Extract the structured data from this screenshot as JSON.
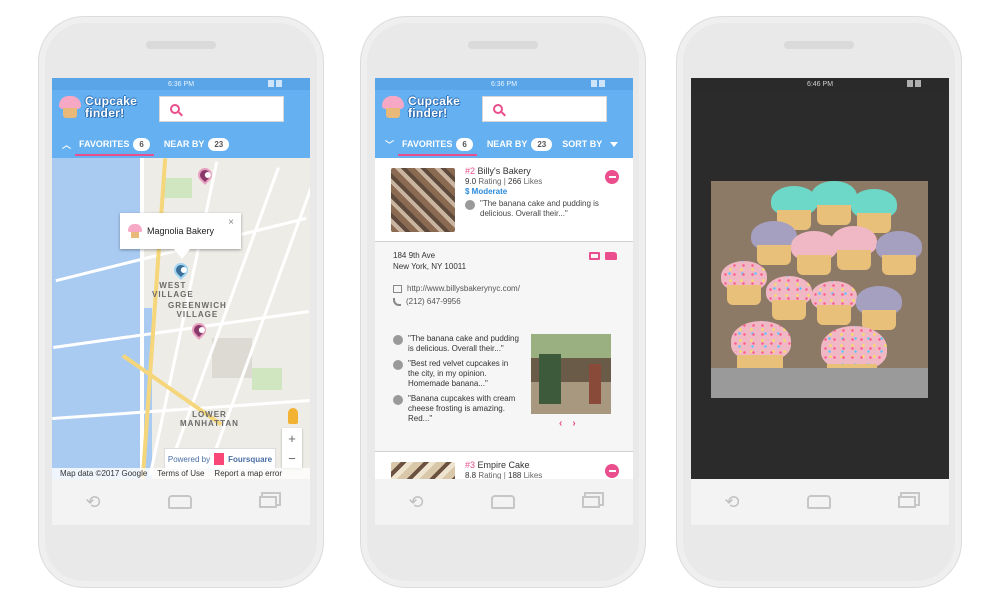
{
  "app": {
    "logo_line1": "Cupcake",
    "logo_line2": "finder!",
    "search_placeholder": ""
  },
  "status_times": [
    "6:36 PM",
    "6:36 PM",
    "6:46 PM"
  ],
  "tabs": {
    "favorites_label": "FAVORITES",
    "favorites_count": "6",
    "nearby_label": "NEAR BY",
    "nearby_count": "23",
    "sort_label": "SORT BY"
  },
  "map": {
    "popup_title": "Magnolia Bakery",
    "popup_close": "×",
    "labels": {
      "west_village_1": "WEST",
      "west_village_2": "VILLAGE",
      "greenwich_1": "GREENWICH",
      "greenwich_2": "VILLAGE",
      "lower_manhattan_1": "LOWER",
      "lower_manhattan_2": "MANHATTAN"
    },
    "powered_by": "Powered by",
    "powered_brand": "Foursquare",
    "attribution": {
      "data": "Map data ©2017 Google",
      "terms": "Terms of Use",
      "report": "Report a map error"
    },
    "zoom_in": "+",
    "zoom_out": "−"
  },
  "list": {
    "items": [
      {
        "rank": "#2",
        "name": "Billy's Bakery",
        "rating": "9.0",
        "rating_label": "Rating",
        "likes": "266",
        "likes_label": "Likes",
        "price": "$ Moderate",
        "review_snippet": "\"The banana cake and pudding is delicious. Overall their...\""
      },
      {
        "rank": "#3",
        "name": "Empire Cake",
        "rating": "8.8",
        "rating_label": "Rating",
        "likes": "188",
        "likes_label": "Likes"
      }
    ],
    "details": {
      "address_line1": "184 9th Ave",
      "address_line2": "New York, NY 10011",
      "website": "http://www.billysbakerynyc.com/",
      "phone": "(212) 647-9956",
      "reviews": [
        "\"The banana cake and pudding is delicious. Overall their...\"",
        "\"Best red velvet cupcakes in the city, in my opinion. Homemade banana...\"",
        "\"Banana cupcakes with cream cheese frosting is amazing. Red...\""
      ],
      "prev": "‹",
      "next": "›"
    }
  },
  "nav": {
    "back": "⟲",
    "home": "",
    "recent": ""
  },
  "colors": {
    "header_blue": "#64b0f0",
    "accent_pink": "#ea4e8c",
    "price_blue": "#2b8cdb"
  },
  "icons": [
    "search-icon",
    "cupcake-logo-icon",
    "chevron-up-icon",
    "chevron-down-icon",
    "close-icon",
    "map-pin-icon",
    "pegman-icon",
    "card-payment-icon",
    "delivery-truck-icon",
    "website-icon",
    "phone-icon",
    "user-avatar-icon",
    "remove-favorite-icon"
  ]
}
